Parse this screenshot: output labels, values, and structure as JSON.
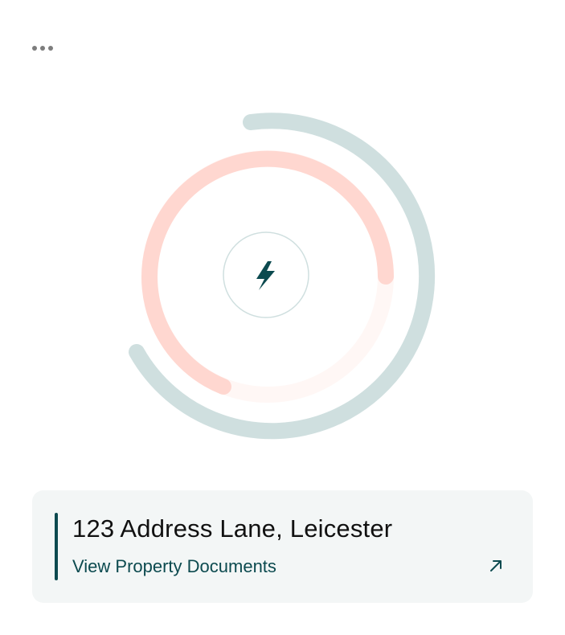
{
  "header": {
    "menu_icon": "more-horizontal-icon"
  },
  "gauge": {
    "center_icon": "lightning-bolt-icon",
    "colors": {
      "outer_ring": "#cfdfdf",
      "inner_ring": "#ffd7d0",
      "inner_track": "#fff7f5",
      "center_circle_border": "#cfdfdf",
      "icon": "#0c4a4f"
    }
  },
  "property": {
    "address": "123 Address Lane, Leicester",
    "link_label": "View Property Documents",
    "link_icon": "arrow-up-right-icon",
    "accent_color": "#0c4a4f",
    "card_background": "#f3f6f6"
  }
}
